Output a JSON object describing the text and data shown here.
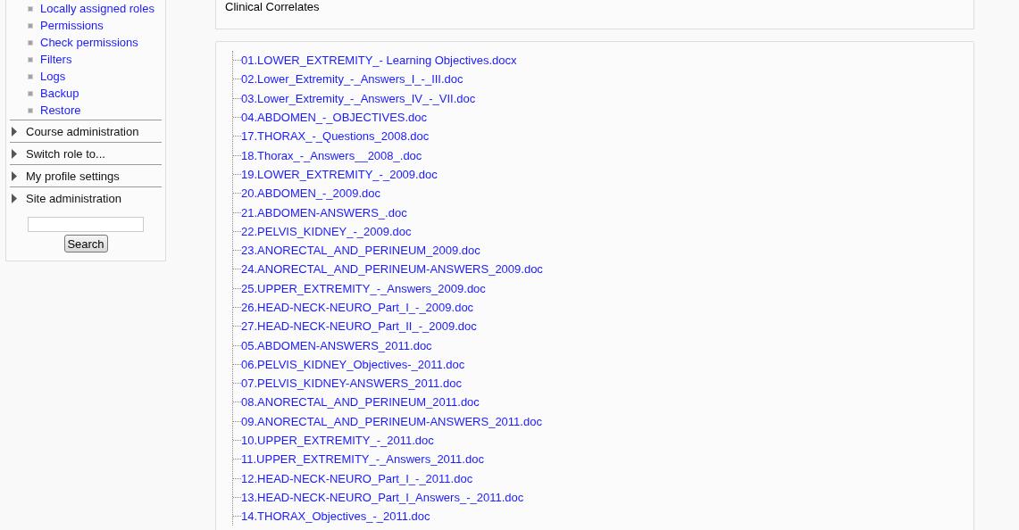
{
  "sidebar": {
    "links": [
      "Locally assigned roles",
      "Permissions",
      "Check permissions",
      "Filters",
      "Logs",
      "Backup",
      "Restore"
    ],
    "sections": [
      {
        "label": "Course administration",
        "expanded": false
      },
      {
        "label": "Switch role to...",
        "expanded": false
      },
      {
        "label": "My profile settings",
        "expanded": false
      },
      {
        "label": "Site administration",
        "expanded": false
      }
    ],
    "search": {
      "button": "Search"
    }
  },
  "main": {
    "section_summary": "Clinical Correlates",
    "files": [
      "01.LOWER_EXTREMITY_- Learning Objectives.docx",
      "02.Lower_Extremity_-_Answers_I_-_III.doc",
      "03.Lower_Extremity_-_Answers_IV_-_VII.doc",
      "04.ABDOMEN_-_OBJECTIVES.doc",
      "17.THORAX_-_Questions_2008.doc",
      "18.Thorax_-_Answers__2008_.doc",
      "19.LOWER_EXTREMITY_-_2009.doc",
      "20.ABDOMEN_-_2009.doc",
      "21.ABDOMEN-ANSWERS_.doc",
      "22.PELVIS_KIDNEY_-_2009.doc",
      "23.ANORECTAL_AND_PERINEUM_2009.doc",
      "24.ANORECTAL_AND_PERINEUM-ANSWERS_2009.doc",
      "25.UPPER_EXTREMITY_-_Answers_2009.doc",
      "26.HEAD-NECK-NEURO_Part_I_-_2009.doc",
      "27.HEAD-NECK-NEURO_Part_II_-_2009.doc",
      "05.ABDOMEN-ANSWERS_2011.doc",
      "06.PELVIS_KIDNEY_Objectives-_2011.doc",
      "07.PELVIS_KIDNEY-ANSWERS_2011.doc",
      "08.ANORECTAL_AND_PERINEUM_2011.doc",
      "09.ANORECTAL_AND_PERINEUM-ANSWERS_2011.doc",
      "10.UPPER_EXTREMITY_-_2011.doc",
      "11.UPPER_EXTREMITY_-_Answers_2011.doc",
      "12.HEAD-NECK-NEURO_Part_I_-_2011.doc",
      "13.HEAD-NECK-NEURO_Part_I_Answers_-_2011.doc",
      "14.THORAX_Objectives_-_2011.doc"
    ]
  }
}
